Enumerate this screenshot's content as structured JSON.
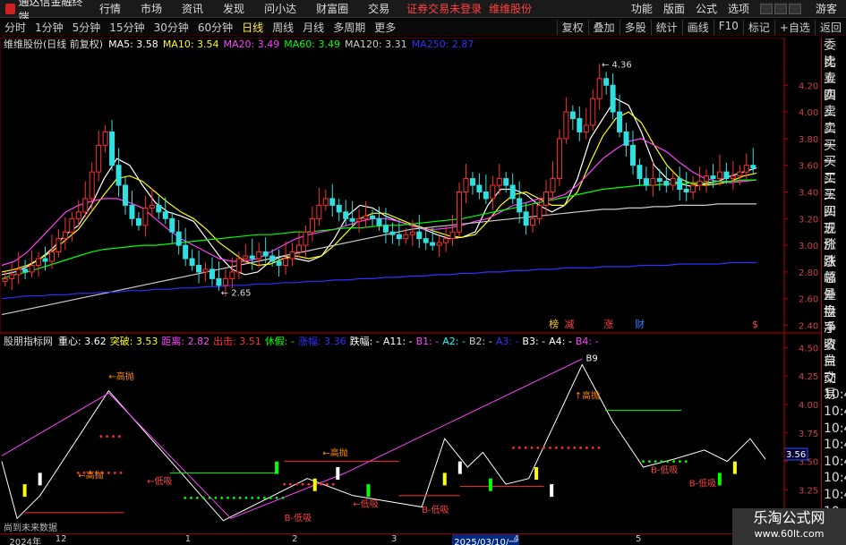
{
  "menu": {
    "app_title": "通达信金融终端",
    "items": [
      "行情",
      "市场",
      "资讯",
      "发现",
      "问小达",
      "财富圈",
      "交易"
    ],
    "notice": "证券交易未登录",
    "stock": "维维股份",
    "right": [
      "功能",
      "版面",
      "公式",
      "选项"
    ],
    "guest": "游客"
  },
  "periods": {
    "items": [
      "分时",
      "1分钟",
      "5分钟",
      "15分钟",
      "30分钟",
      "60分钟",
      "日线",
      "周线",
      "月线",
      "多周期",
      "更多"
    ],
    "active": "日线"
  },
  "toolbar_right": [
    "复权",
    "叠加",
    "多股",
    "统计",
    "画线",
    "F10",
    "标记",
    "+自选",
    "返回"
  ],
  "main_info": {
    "name": "维维股份(日线 前复权)",
    "ma": [
      {
        "label": "MA5:",
        "value": "3.58",
        "color": "#ffffff"
      },
      {
        "label": "MA10:",
        "value": "3.54",
        "color": "#ffff00"
      },
      {
        "label": "MA20:",
        "value": "3.49",
        "color": "#ff40ff"
      },
      {
        "label": "MA60:",
        "value": "3.49",
        "color": "#00ff00"
      },
      {
        "label": "MA120:",
        "value": "3.31",
        "color": "#cccccc"
      },
      {
        "label": "MA250:",
        "value": "2.87",
        "color": "#3030ff"
      }
    ]
  },
  "price_axis": [
    "4.20",
    "4.00",
    "3.80",
    "3.60",
    "3.40",
    "3.20",
    "3.00",
    "2.80",
    "2.60",
    "2.40"
  ],
  "ind_axis": [
    "4.50",
    "4.25",
    "4.00",
    "3.75",
    "3.50",
    "3.25",
    "3.00"
  ],
  "current_price": "3.56",
  "ind_info": {
    "name": "股朋指标网",
    "items": [
      {
        "label": "重心:",
        "value": "3.62",
        "color": "#ffffff"
      },
      {
        "label": "突破:",
        "value": "3.53",
        "color": "#ffff00"
      },
      {
        "label": "距离:",
        "value": "2.82",
        "color": "#ff40ff"
      },
      {
        "label": "出击:",
        "value": "3.51",
        "color": "#ff3030"
      },
      {
        "label": "休假:",
        "value": "-",
        "color": "#00ff00"
      },
      {
        "label": "涨幅:",
        "value": "3.36",
        "color": "#3030ff"
      },
      {
        "label": "跌幅:",
        "value": "-",
        "color": "#ffffff"
      },
      {
        "label": "A11:",
        "value": "-",
        "color": "#ffffff"
      },
      {
        "label": "B1:",
        "value": "-",
        "color": "#ff40ff"
      },
      {
        "label": "A2:",
        "value": "-",
        "color": "#00ffff"
      },
      {
        "label": "B2:",
        "value": "-",
        "color": "#cccccc"
      },
      {
        "label": "A3:",
        "value": "-",
        "color": "#3030ff"
      },
      {
        "label": "B3:",
        "value": "-",
        "color": "#ffffff"
      },
      {
        "label": "A4:",
        "value": "-",
        "color": "#ffffff"
      },
      {
        "label": "B4:",
        "value": "-",
        "color": "#ff40ff"
      }
    ]
  },
  "side_items": [
    "委比",
    "卖五",
    "卖四",
    "卖三",
    "卖二",
    "卖一",
    "买一",
    "买二",
    "买三",
    "买四",
    "买五",
    "现价",
    "涨跌",
    "涨幅",
    "总量",
    "外盘",
    "换手",
    "净资",
    "收益",
    "自动",
    "交易",
    "10:44",
    "10:44",
    "10:44",
    "10:44",
    "10:44",
    "10:44",
    "10:44",
    "10:44",
    "10:44"
  ],
  "chart_data": {
    "type": "candlestick",
    "price_range": [
      2.37,
      4.45
    ],
    "indicator_range": [
      2.9,
      4.55
    ],
    "highest_label": "4.36",
    "lowest_label": "2.65",
    "high": 4.36,
    "low": 2.65,
    "closes": [
      2.75,
      2.78,
      2.82,
      2.8,
      2.85,
      2.9,
      2.88,
      2.95,
      3.05,
      3.1,
      3.2,
      3.25,
      3.35,
      3.55,
      3.75,
      3.85,
      3.6,
      3.45,
      3.3,
      3.2,
      3.15,
      3.28,
      3.3,
      3.25,
      3.2,
      3.1,
      3.0,
      2.9,
      2.85,
      2.8,
      2.82,
      2.75,
      2.7,
      2.75,
      2.8,
      2.9,
      2.92,
      2.9,
      2.95,
      2.92,
      2.88,
      2.85,
      2.9,
      2.95,
      3.0,
      3.1,
      3.2,
      3.3,
      3.35,
      3.3,
      3.25,
      3.2,
      3.18,
      3.2,
      3.22,
      3.2,
      3.15,
      3.1,
      3.08,
      3.05,
      3.08,
      3.1,
      3.05,
      3.02,
      3.0,
      3.02,
      3.05,
      3.1,
      3.4,
      3.5,
      3.45,
      3.4,
      3.35,
      3.45,
      3.5,
      3.45,
      3.35,
      3.25,
      3.15,
      3.2,
      3.3,
      3.4,
      3.5,
      3.8,
      4.0,
      3.95,
      3.85,
      3.9,
      4.1,
      4.25,
      4.2,
      4.0,
      3.85,
      3.75,
      3.6,
      3.5,
      3.45,
      3.5,
      3.48,
      3.45,
      3.5,
      3.42,
      3.4,
      3.45,
      3.48,
      3.52,
      3.5,
      3.55,
      3.5,
      3.52,
      3.55,
      3.6,
      3.58
    ],
    "moving_averages": [
      {
        "name": "MA5",
        "color": "#ffffff",
        "values": [
          2.78,
          2.8,
          2.84,
          2.9,
          2.98,
          3.08,
          3.15,
          3.3,
          3.5,
          3.65,
          3.6,
          3.45,
          3.32,
          3.25,
          3.22,
          3.18,
          3.05,
          2.92,
          2.82,
          2.78,
          2.8,
          2.88,
          2.92,
          2.9,
          2.88,
          2.92,
          3.05,
          3.22,
          3.3,
          3.28,
          3.22,
          3.18,
          3.15,
          3.12,
          3.08,
          3.05,
          3.06,
          3.1,
          3.3,
          3.42,
          3.42,
          3.38,
          3.3,
          3.25,
          3.3,
          3.5,
          3.8,
          3.95,
          4.1,
          4.05,
          3.85,
          3.6,
          3.5,
          3.46,
          3.44,
          3.46,
          3.48,
          3.52,
          3.55,
          3.58
        ]
      },
      {
        "name": "MA10",
        "color": "#ffff00",
        "values": [
          2.8,
          2.82,
          2.85,
          2.9,
          2.96,
          3.04,
          3.12,
          3.25,
          3.38,
          3.5,
          3.52,
          3.48,
          3.4,
          3.32,
          3.25,
          3.2,
          3.12,
          3.02,
          2.95,
          2.88,
          2.85,
          2.86,
          2.9,
          2.92,
          2.9,
          2.92,
          3.0,
          3.1,
          3.2,
          3.24,
          3.24,
          3.2,
          3.16,
          3.13,
          3.1,
          3.07,
          3.06,
          3.08,
          3.18,
          3.3,
          3.38,
          3.4,
          3.35,
          3.3,
          3.3,
          3.4,
          3.62,
          3.82,
          3.95,
          4.0,
          3.92,
          3.75,
          3.6,
          3.5,
          3.46,
          3.45,
          3.46,
          3.48,
          3.52,
          3.54
        ]
      },
      {
        "name": "MA20",
        "color": "#ff40ff",
        "values": [
          2.85,
          2.88,
          2.95,
          3.05,
          3.15,
          3.25,
          3.3,
          3.33,
          3.35,
          3.35,
          3.32,
          3.28,
          3.2,
          3.12,
          3.05,
          3.0,
          2.95,
          2.9,
          2.88,
          2.88,
          2.9,
          2.95,
          3.0,
          3.05,
          3.08,
          3.1,
          3.12,
          3.15,
          3.18,
          3.2,
          3.2,
          3.18,
          3.15,
          3.12,
          3.12,
          3.13,
          3.15,
          3.18,
          3.2,
          3.25,
          3.3,
          3.32,
          3.35,
          3.35,
          3.38,
          3.45,
          3.55,
          3.65,
          3.72,
          3.78,
          3.8,
          3.75,
          3.7,
          3.62,
          3.55,
          3.5,
          3.48,
          3.47,
          3.48,
          3.49
        ]
      },
      {
        "name": "MA60",
        "color": "#00ff00",
        "values": [
          2.75,
          2.78,
          2.8,
          2.83,
          2.86,
          2.89,
          2.92,
          2.95,
          2.97,
          2.98,
          2.99,
          3.0,
          3.0,
          3.01,
          3.02,
          3.03,
          3.04,
          3.05,
          3.06,
          3.07,
          3.08,
          3.08,
          3.09,
          3.1,
          3.1,
          3.11,
          3.12,
          3.13,
          3.13,
          3.14,
          3.15,
          3.15,
          3.16,
          3.17,
          3.18,
          3.19,
          3.2,
          3.22,
          3.24,
          3.26,
          3.28,
          3.3,
          3.32,
          3.34,
          3.36,
          3.38,
          3.4,
          3.42,
          3.43,
          3.44,
          3.45,
          3.45,
          3.46,
          3.46,
          3.47,
          3.47,
          3.48,
          3.48,
          3.49,
          3.49
        ]
      },
      {
        "name": "MA120",
        "color": "#cccccc",
        "values": [
          2.48,
          2.5,
          2.52,
          2.54,
          2.56,
          2.58,
          2.6,
          2.62,
          2.64,
          2.66,
          2.68,
          2.7,
          2.72,
          2.74,
          2.76,
          2.78,
          2.8,
          2.82,
          2.84,
          2.86,
          2.88,
          2.9,
          2.92,
          2.94,
          2.96,
          2.98,
          3.0,
          3.02,
          3.04,
          3.06,
          3.08,
          3.1,
          3.12,
          3.13,
          3.14,
          3.15,
          3.16,
          3.17,
          3.18,
          3.19,
          3.2,
          3.21,
          3.22,
          3.23,
          3.24,
          3.25,
          3.26,
          3.27,
          3.27,
          3.28,
          3.28,
          3.29,
          3.29,
          3.3,
          3.3,
          3.3,
          3.31,
          3.31,
          3.31,
          3.31
        ]
      },
      {
        "name": "MA250",
        "color": "#3030ff",
        "values": [
          2.6,
          2.61,
          2.62,
          2.62,
          2.63,
          2.63,
          2.64,
          2.64,
          2.65,
          2.65,
          2.66,
          2.66,
          2.67,
          2.67,
          2.68,
          2.68,
          2.69,
          2.69,
          2.7,
          2.7,
          2.71,
          2.71,
          2.72,
          2.72,
          2.73,
          2.73,
          2.74,
          2.74,
          2.75,
          2.75,
          2.76,
          2.76,
          2.77,
          2.77,
          2.78,
          2.78,
          2.79,
          2.79,
          2.8,
          2.8,
          2.81,
          2.81,
          2.82,
          2.82,
          2.83,
          2.83,
          2.83,
          2.84,
          2.84,
          2.84,
          2.85,
          2.85,
          2.85,
          2.86,
          2.86,
          2.86,
          2.86,
          2.87,
          2.87,
          2.87
        ]
      }
    ],
    "indicator_zigzag": [
      {
        "x": 0.0,
        "y": 3.5
      },
      {
        "x": 0.02,
        "y": 3.0
      },
      {
        "x": 0.05,
        "y": 3.2
      },
      {
        "x": 0.14,
        "y": 4.12
      },
      {
        "x": 0.29,
        "y": 2.98
      },
      {
        "x": 0.4,
        "y": 3.35
      },
      {
        "x": 0.46,
        "y": 3.2
      },
      {
        "x": 0.55,
        "y": 3.1
      },
      {
        "x": 0.58,
        "y": 3.7
      },
      {
        "x": 0.61,
        "y": 3.45
      },
      {
        "x": 0.63,
        "y": 3.58
      },
      {
        "x": 0.66,
        "y": 3.3
      },
      {
        "x": 0.69,
        "y": 3.35
      },
      {
        "x": 0.76,
        "y": 4.35
      },
      {
        "x": 0.8,
        "y": 3.85
      },
      {
        "x": 0.84,
        "y": 3.45
      },
      {
        "x": 0.88,
        "y": 3.52
      },
      {
        "x": 0.92,
        "y": 3.6
      },
      {
        "x": 0.95,
        "y": 3.5
      },
      {
        "x": 0.98,
        "y": 3.7
      },
      {
        "x": 1.0,
        "y": 3.52
      }
    ],
    "indicator_trend": [
      {
        "x": 0.0,
        "y": 3.55
      },
      {
        "x": 0.14,
        "y": 4.1
      },
      {
        "x": 0.3,
        "y": 3.0
      },
      {
        "x": 0.45,
        "y": 3.4
      },
      {
        "x": 0.76,
        "y": 4.4
      }
    ],
    "indicator_labels": [
      {
        "text": "←高抛",
        "x": 0.14,
        "y": 4.22,
        "color": "#ff8800"
      },
      {
        "text": "←高抛",
        "x": 0.1,
        "y": 3.35,
        "color": "#ff8800"
      },
      {
        "text": "←低吸",
        "x": 0.19,
        "y": 3.3,
        "color": "#ff4040"
      },
      {
        "text": "←高抛",
        "x": 0.42,
        "y": 3.55,
        "color": "#ff8800"
      },
      {
        "text": "←低吸",
        "x": 0.46,
        "y": 3.1,
        "color": "#ff4040"
      },
      {
        "text": "B-低吸",
        "x": 0.37,
        "y": 2.98,
        "color": "#ff4040"
      },
      {
        "text": "B-低吸",
        "x": 0.55,
        "y": 3.05,
        "color": "#ff4040"
      },
      {
        "text": "B-低吸",
        "x": 0.85,
        "y": 3.4,
        "color": "#ff4040"
      },
      {
        "text": "B-低吸",
        "x": 0.9,
        "y": 3.28,
        "color": "#ff4040"
      },
      {
        "text": "↑高抛",
        "x": 0.75,
        "y": 4.05,
        "color": "#ff8800"
      },
      {
        "text": "B9",
        "x": 0.765,
        "y": 4.38,
        "color": "#ffffff"
      }
    ],
    "date_labels": [
      {
        "text": "2024年",
        "x": 0.01
      },
      {
        "text": "12",
        "x": 0.07
      },
      {
        "text": "1",
        "x": 0.24
      },
      {
        "text": "2",
        "x": 0.38
      },
      {
        "text": "3",
        "x": 0.51
      },
      {
        "text": "2025/03/10/一",
        "x": 0.59
      },
      {
        "text": "4",
        "x": 0.67
      },
      {
        "text": "5",
        "x": 0.83
      }
    ],
    "badges": [
      {
        "text": "榜",
        "x": 0.7,
        "color": "#ffcc00"
      },
      {
        "text": "减",
        "x": 0.72,
        "color": "#ff4040"
      },
      {
        "text": "涨",
        "x": 0.77,
        "color": "#ff4040"
      },
      {
        "text": "财",
        "x": 0.81,
        "color": "#3080ff"
      },
      {
        "text": "$",
        "x": 0.96,
        "color": "#ff4040"
      }
    ],
    "no_future_data": "尚到未来数据"
  },
  "watermark": {
    "title": "乐淘公式网",
    "url": "www.60lt.com"
  }
}
